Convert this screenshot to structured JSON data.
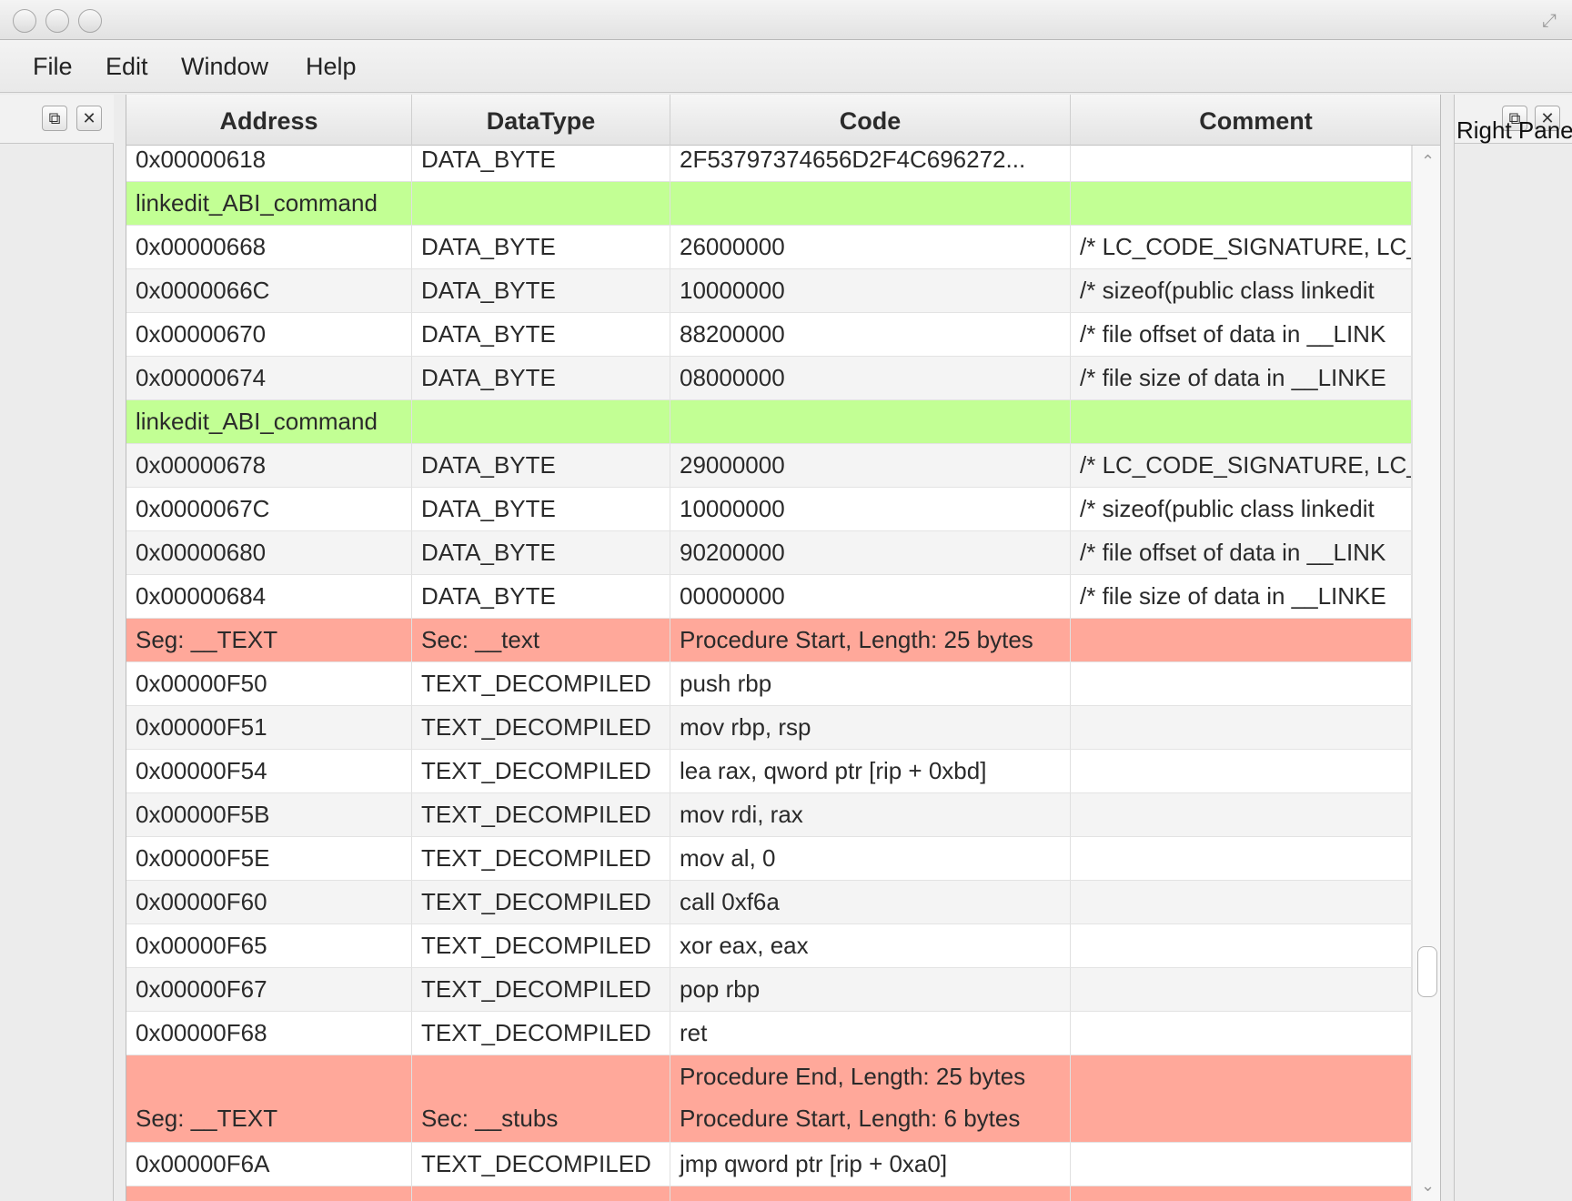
{
  "window": {
    "menu": [
      "File",
      "Edit",
      "Window",
      "Help"
    ]
  },
  "left_pane": {
    "restore_icon": "⧉",
    "close_icon": "✕"
  },
  "right_pane": {
    "title": "Right Pane",
    "restore_icon": "⧉",
    "close_icon": "✕"
  },
  "table": {
    "columns": [
      "Address",
      "DataType",
      "Code",
      "Comment"
    ],
    "row_colors": {
      "normal": "#ffffff",
      "alt": "#f4f4f4",
      "green": "#c2ff94",
      "red": "#ffa89a"
    },
    "rows": [
      {
        "kind": "normal",
        "cells": [
          "0x00000618",
          "DATA_BYTE",
          "2F53797374656D2F4C696272...",
          ""
        ]
      },
      {
        "kind": "green",
        "cells": [
          "linkedit_ABI_command",
          "",
          "",
          ""
        ]
      },
      {
        "kind": "normal",
        "cells": [
          "0x00000668",
          "DATA_BYTE",
          "26000000",
          "/* LC_CODE_SIGNATURE, LC_"
        ]
      },
      {
        "kind": "alt",
        "cells": [
          "0x0000066C",
          "DATA_BYTE",
          "10000000",
          "/* sizeof(public class linkedit"
        ]
      },
      {
        "kind": "normal",
        "cells": [
          "0x00000670",
          "DATA_BYTE",
          "88200000",
          "/* file offset of data in __LINK"
        ]
      },
      {
        "kind": "alt",
        "cells": [
          "0x00000674",
          "DATA_BYTE",
          "08000000",
          "/* file size of data in __LINKE"
        ]
      },
      {
        "kind": "green",
        "cells": [
          "linkedit_ABI_command",
          "",
          "",
          ""
        ]
      },
      {
        "kind": "alt",
        "cells": [
          "0x00000678",
          "DATA_BYTE",
          "29000000",
          "/* LC_CODE_SIGNATURE, LC_"
        ]
      },
      {
        "kind": "normal",
        "cells": [
          "0x0000067C",
          "DATA_BYTE",
          "10000000",
          "/* sizeof(public class linkedit"
        ]
      },
      {
        "kind": "alt",
        "cells": [
          "0x00000680",
          "DATA_BYTE",
          "90200000",
          "/* file offset of data in __LINK"
        ]
      },
      {
        "kind": "normal",
        "cells": [
          "0x00000684",
          "DATA_BYTE",
          "00000000",
          "/* file size of data in __LINKE"
        ]
      },
      {
        "kind": "red",
        "cells": [
          "Seg: __TEXT",
          "Sec: __text",
          "Procedure Start, Length: 25 bytes",
          ""
        ]
      },
      {
        "kind": "normal",
        "cells": [
          "0x00000F50",
          "TEXT_DECOMPILED",
          "push rbp",
          ""
        ]
      },
      {
        "kind": "alt",
        "cells": [
          "0x00000F51",
          "TEXT_DECOMPILED",
          "mov rbp, rsp",
          ""
        ]
      },
      {
        "kind": "normal",
        "cells": [
          "0x00000F54",
          "TEXT_DECOMPILED",
          "lea rax, qword ptr [rip + 0xbd]",
          ""
        ]
      },
      {
        "kind": "alt",
        "cells": [
          "0x00000F5B",
          "TEXT_DECOMPILED",
          "mov rdi, rax",
          ""
        ]
      },
      {
        "kind": "normal",
        "cells": [
          "0x00000F5E",
          "TEXT_DECOMPILED",
          "mov al, 0",
          ""
        ]
      },
      {
        "kind": "alt",
        "cells": [
          "0x00000F60",
          "TEXT_DECOMPILED",
          "call 0xf6a",
          ""
        ]
      },
      {
        "kind": "normal",
        "cells": [
          "0x00000F65",
          "TEXT_DECOMPILED",
          "xor eax, eax",
          ""
        ]
      },
      {
        "kind": "alt",
        "cells": [
          "0x00000F67",
          "TEXT_DECOMPILED",
          "pop rbp",
          ""
        ]
      },
      {
        "kind": "normal",
        "cells": [
          "0x00000F68",
          "TEXT_DECOMPILED",
          "ret",
          ""
        ]
      },
      {
        "kind": "red",
        "double": true,
        "cells": [
          "Seg: __TEXT",
          "Sec: __stubs",
          "Procedure End, Length: 25 bytes\nProcedure Start, Length: 6 bytes",
          ""
        ]
      },
      {
        "kind": "normal",
        "cells": [
          "0x00000F6A",
          "TEXT_DECOMPILED",
          "jmp qword ptr [rip + 0xa0]",
          ""
        ]
      },
      {
        "kind": "red",
        "cells": [
          "",
          "",
          "",
          ""
        ]
      }
    ]
  },
  "scrollbar": {
    "up_icon": "⌃",
    "down_icon": "⌄"
  }
}
